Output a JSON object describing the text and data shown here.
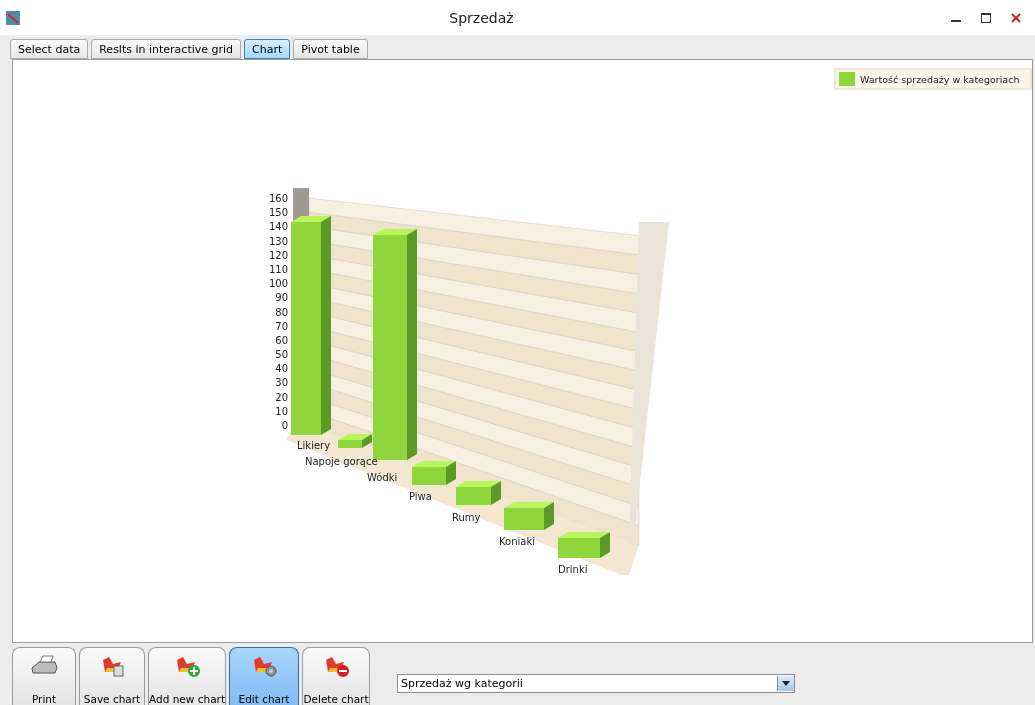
{
  "window": {
    "title": "Sprzedaż"
  },
  "tabs": [
    {
      "label": "Select data",
      "selected": false
    },
    {
      "label": "Reslts in interactive grid",
      "selected": false
    },
    {
      "label": "Chart",
      "selected": true
    },
    {
      "label": "Pivot table",
      "selected": false
    }
  ],
  "chart": {
    "y_axis_labels": [
      "160",
      "150",
      "140",
      "130",
      "120",
      "110",
      "100",
      "90",
      "80",
      "70",
      "60",
      "50",
      "40",
      "30",
      "20",
      "10",
      "0"
    ],
    "categories": [
      "Likiery",
      "Napoje gorące",
      "Wódki",
      "Piwa",
      "Rumy",
      "Koniaki",
      "Drinki"
    ],
    "legend": "Wartość sprzedaży w kategoriach"
  },
  "toolbar": [
    {
      "kind": "print",
      "label": "Print",
      "selected": false
    },
    {
      "kind": "save",
      "label": "Save chart",
      "selected": false
    },
    {
      "kind": "add",
      "label": "Add new chart",
      "selected": false
    },
    {
      "kind": "edit",
      "label": "Edit chart",
      "selected": true
    },
    {
      "kind": "delete",
      "label": "Delete chart",
      "selected": false
    }
  ],
  "chart_selector": {
    "value": "Sprzedaż wg kategorii"
  }
}
